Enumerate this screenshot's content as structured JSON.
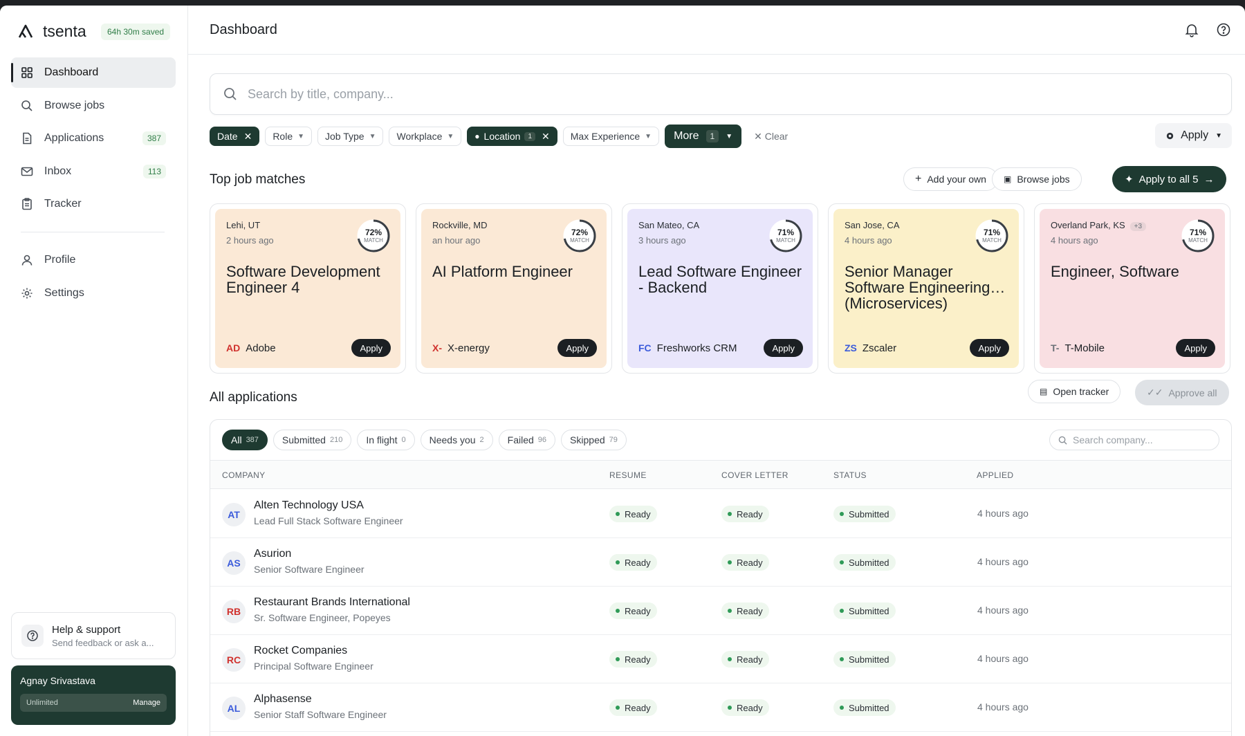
{
  "app": {
    "name": "tsenta",
    "saved": "64h 30m saved"
  },
  "nav": [
    {
      "label": "Dashboard",
      "icon": "grid-icon"
    },
    {
      "label": "Browse jobs",
      "icon": "search-icon"
    },
    {
      "label": "Applications",
      "icon": "document-icon",
      "count": "387"
    },
    {
      "label": "Inbox",
      "icon": "mail-icon",
      "count": "113"
    },
    {
      "label": "Tracker",
      "icon": "clipboard-icon"
    },
    {
      "label": "Profile",
      "icon": "user-icon"
    },
    {
      "label": "Settings",
      "icon": "gear-icon"
    }
  ],
  "help": {
    "title": "Help & support",
    "subtitle": "Send feedback or ask a..."
  },
  "user": {
    "name": "Agnay Srivastava",
    "plan": "Unlimited",
    "manage": "Manage"
  },
  "header": {
    "title": "Dashboard"
  },
  "search": {
    "placeholder": "Search by title, company..."
  },
  "filters": {
    "date": "Date",
    "role": "Role",
    "job_type": "Job Type",
    "workplace": "Workplace",
    "location": "Location",
    "location_count": "1",
    "max_experience": "Max Experience",
    "more": "More",
    "more_count": "1",
    "clear": "Clear",
    "apply": "Apply"
  },
  "matches": {
    "title": "Top job matches",
    "add_own": "Add your own",
    "browse": "Browse jobs",
    "apply_all": "Apply to all 5",
    "match_label": "MATCH",
    "apply_label": "Apply",
    "cards": [
      {
        "location": "Lehi, UT",
        "ago": "2 hours ago",
        "match": "72%",
        "role": "Software Development Engineer 4",
        "logo": "AD",
        "company": "Adobe",
        "bg": "#fbe9d6",
        "logo_color": "#d0312d"
      },
      {
        "location": "Rockville, MD",
        "ago": "an hour ago",
        "match": "72%",
        "role": "AI Platform Engineer",
        "logo": "X-",
        "company": "X-energy",
        "bg": "#fbe9d6",
        "logo_color": "#d0312d"
      },
      {
        "location": "San Mateo, CA",
        "ago": "3 hours ago",
        "match": "71%",
        "role": "Lead Software Engineer - Backend",
        "logo": "FC",
        "company": "Freshworks CRM",
        "bg": "#e9e6fb",
        "logo_color": "#3b5bdb"
      },
      {
        "location": "San Jose, CA",
        "ago": "4 hours ago",
        "match": "71%",
        "role": "Senior Manager Software Engineering… (Microservices)",
        "logo": "ZS",
        "company": "Zscaler",
        "bg": "#fbf0c9",
        "logo_color": "#3b5bdb"
      },
      {
        "location": "Overland Park, KS",
        "extra": "+3",
        "ago": "4 hours ago",
        "match": "71%",
        "role": "Engineer, Software",
        "logo": "T-",
        "company": "T-Mobile",
        "bg": "#f9dfe2",
        "logo_color": "#6b7178"
      }
    ]
  },
  "applications": {
    "title": "All applications",
    "open_tracker": "Open tracker",
    "approve_all": "Approve all",
    "tabs": [
      {
        "label": "All",
        "count": "387"
      },
      {
        "label": "Submitted",
        "count": "210"
      },
      {
        "label": "In flight",
        "count": "0"
      },
      {
        "label": "Needs you",
        "count": "2"
      },
      {
        "label": "Failed",
        "count": "96"
      },
      {
        "label": "Skipped",
        "count": "79"
      }
    ],
    "search_placeholder": "Search company...",
    "columns": {
      "company": "COMPANY",
      "resume": "RESUME",
      "cover": "COVER LETTER",
      "status": "STATUS",
      "applied": "APPLIED"
    },
    "rows": [
      {
        "initials": "AT",
        "company": "Alten Technology USA",
        "role": "Lead Full Stack Software Engineer",
        "resume": "Ready",
        "cover": "Ready",
        "status": "Submitted",
        "applied": "4 hours ago",
        "color": "#3b5bdb"
      },
      {
        "initials": "AS",
        "company": "Asurion",
        "role": "Senior Software Engineer",
        "resume": "Ready",
        "cover": "Ready",
        "status": "Submitted",
        "applied": "4 hours ago",
        "color": "#3b5bdb"
      },
      {
        "initials": "RB",
        "company": "Restaurant Brands International",
        "role": "Sr. Software Engineer, Popeyes",
        "resume": "Ready",
        "cover": "Ready",
        "status": "Submitted",
        "applied": "4 hours ago",
        "color": "#d0312d"
      },
      {
        "initials": "RC",
        "company": "Rocket Companies",
        "role": "Principal Software Engineer",
        "resume": "Ready",
        "cover": "Ready",
        "status": "Submitted",
        "applied": "4 hours ago",
        "color": "#d0312d"
      },
      {
        "initials": "AL",
        "company": "Alphasense",
        "role": "Senior Staff Software Engineer",
        "resume": "Ready",
        "cover": "Ready",
        "status": "Submitted",
        "applied": "4 hours ago",
        "color": "#3b5bdb"
      }
    ]
  }
}
